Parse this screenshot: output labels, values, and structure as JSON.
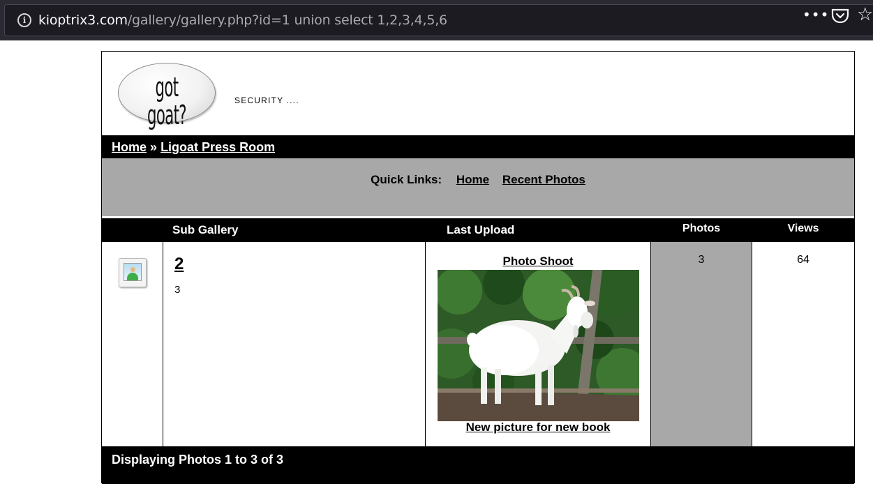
{
  "browser": {
    "url_host": "kioptrix3.com",
    "url_path": "/gallery/gallery.php?id=1 union select 1,2,3,4,5,6",
    "icons": [
      "info-icon",
      "more-icon",
      "pocket-icon",
      "star-icon"
    ]
  },
  "header": {
    "logo_text": "got goat?",
    "tagline": "SECURITY ...."
  },
  "breadcrumb": {
    "home": "Home",
    "separator": "»",
    "current": "Ligoat Press Room"
  },
  "quick_links": {
    "label": "Quick Links:",
    "items": [
      "Home",
      "Recent Photos"
    ]
  },
  "table": {
    "headers": {
      "sub_gallery": "Sub Gallery",
      "last_upload": "Last Upload",
      "photos": "Photos",
      "views": "Views"
    },
    "row": {
      "title": "2",
      "count": "3",
      "upload_title": "Photo Shoot",
      "upload_caption": "New picture for new book",
      "photos": "3",
      "views": "64"
    }
  },
  "footer": {
    "text": "Displaying Photos 1 to 3 of 3"
  },
  "colors": {
    "bar": "#000000",
    "panel_gray": "#a8a8a8",
    "browser_bg": "#2b2a33"
  }
}
